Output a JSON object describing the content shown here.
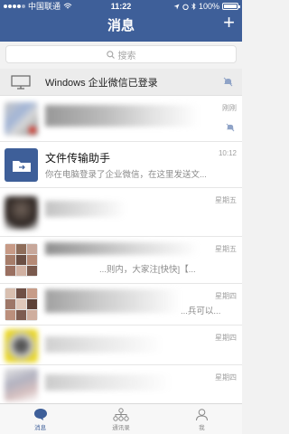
{
  "status_bar": {
    "carrier": "中国联通",
    "time": "11:22",
    "battery": "100%"
  },
  "header": {
    "title": "消息"
  },
  "search": {
    "placeholder": "搜索"
  },
  "banner": {
    "text": "Windows 企业微信已登录"
  },
  "messages": [
    {
      "name": "",
      "preview": "",
      "time": "刚刚"
    },
    {
      "name": "文件传输助手",
      "preview": "你在电脑登录了企业微信，在这里发送文...",
      "time": "10:12"
    },
    {
      "name": "",
      "preview": "",
      "time": "星期五"
    },
    {
      "name": "",
      "preview": "...则内，大家注[快快]【...",
      "time": "星期五"
    },
    {
      "name": "",
      "preview": "...兵可以...",
      "time": "星期四"
    },
    {
      "name": "",
      "preview": "",
      "time": "星期四"
    },
    {
      "name": "",
      "preview": "",
      "time": "星期四"
    }
  ],
  "tabbar": [
    {
      "label": "消息",
      "icon": "chat-bubble-icon"
    },
    {
      "label": "通讯录",
      "icon": "org-chart-icon"
    },
    {
      "label": "我",
      "icon": "person-icon"
    }
  ],
  "colors": {
    "brand": "#3e5f99",
    "background": "#f2f2f2"
  }
}
